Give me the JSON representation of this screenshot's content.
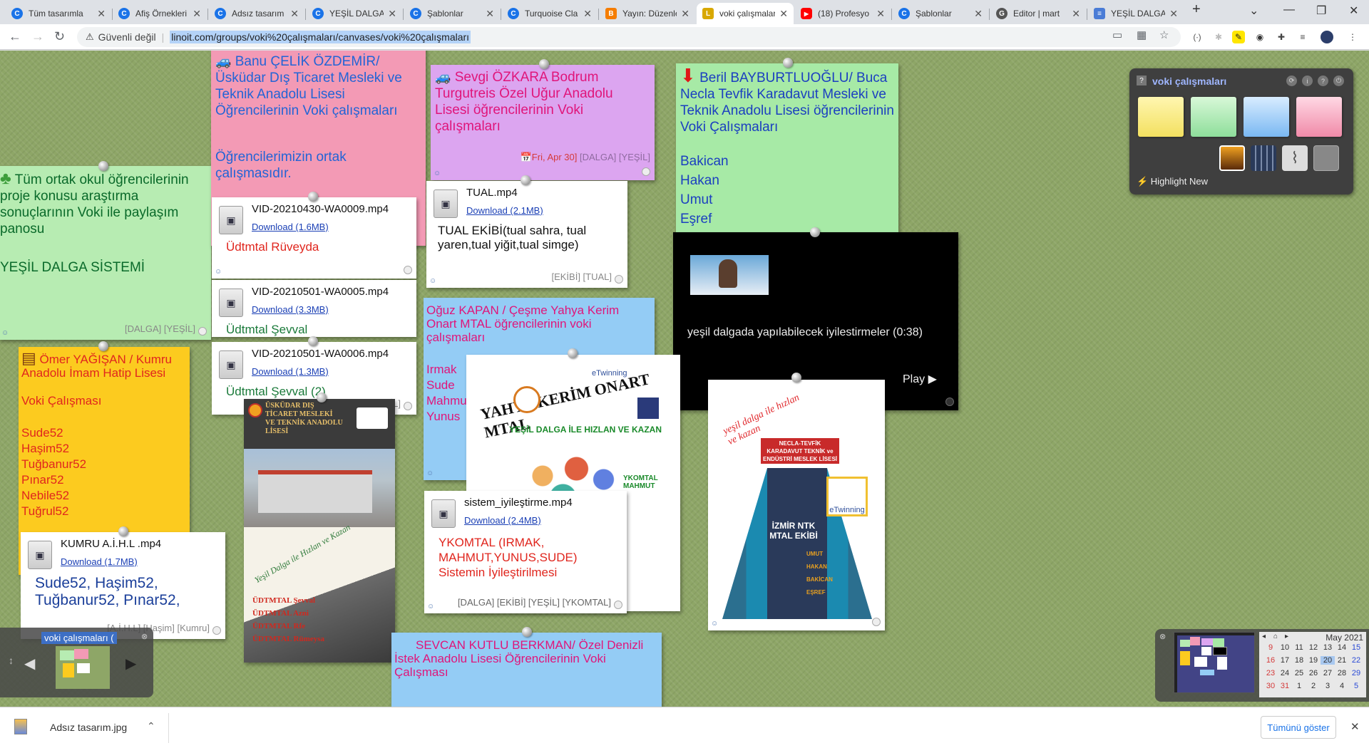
{
  "browser": {
    "tabs": [
      {
        "title": "Tüm tasarımla",
        "favicon": "C",
        "color": "#1a73e8"
      },
      {
        "title": "Afiş Örnekleri",
        "favicon": "C",
        "color": "#1a73e8"
      },
      {
        "title": "Adsız tasarım",
        "favicon": "C",
        "color": "#1a73e8"
      },
      {
        "title": "YEŞİL DALGA",
        "favicon": "C",
        "color": "#1a73e8"
      },
      {
        "title": "Şablonlar",
        "favicon": "C",
        "color": "#1a73e8"
      },
      {
        "title": "Turquoise Cla",
        "favicon": "C",
        "color": "#1a73e8"
      },
      {
        "title": "Yayın: Düzenle",
        "favicon": "B",
        "color": "#f57d00"
      },
      {
        "title": "voki çalışmaları",
        "favicon": "L",
        "color": "#d8a800"
      },
      {
        "title": "(18) Profesyo",
        "favicon": "▶",
        "color": "#ff0000"
      },
      {
        "title": "Şablonlar",
        "favicon": "C",
        "color": "#1a73e8"
      },
      {
        "title": "Editor | mart",
        "favicon": "G",
        "color": "#555"
      },
      {
        "title": "YEŞİL DALGA",
        "favicon": "≡",
        "color": "#4a7cd6"
      }
    ],
    "new_tab": "+",
    "address": {
      "warning": "⚠",
      "insecure_label": "Güvenli değil",
      "url": "linoit.com/groups/voki%20çalışmaları/canvases/voki%20çalışmaları"
    }
  },
  "notes": {
    "banu": {
      "title": "Banu ÇELİK ÖZDEMİR/ Üsküdar Dış Ticaret Mesleki ve Teknik Anadolu Lisesi Öğrencilerinin Voki çalışmaları",
      "body": "Öğrencilerimizin ortak çalışmasıdır."
    },
    "sevgi": {
      "title": "Sevgi ÖZKARA Bodrum Turgutreis Özel Uğur Anadolu Lisesi öğrencilerinin Voki çalışmaları",
      "date": "📅Fri, Apr 30]",
      "tags": "[DALGA] [YEŞİL]"
    },
    "beril": {
      "title": "Beril BAYBURTLUOĞLU/ Buca Necla Tevfik Karadavut Mesleki ve Teknik Anadolu Lisesi öğrencilerinin Voki Çalışmaları",
      "names": [
        "Bakican",
        "Hakan",
        "Umut",
        "Eşref"
      ]
    },
    "tum": {
      "title": "Tüm ortak okul öğrencilerinin proje konusu araştırma sonuçlarının Voki ile paylaşım panosu",
      "body": "YEŞİL DALGA SİSTEMİ",
      "tags": "[DALGA] [YEŞİL]"
    },
    "omer": {
      "title": "Ömer YAĞIŞAN / Kumru Anadolu İmam Hatip Lisesi",
      "subtitle": "Voki Çalışması",
      "names": [
        "Sude52",
        "Haşim52",
        "Tuğbanur52",
        "Pınar52",
        "Nebile52",
        "Tuğrul52"
      ]
    },
    "oguz": {
      "title": "Oğuz KAPAN / Çeşme Yahya Kerim Onart MTAL öğrencilerinin voki çalışmaları",
      "names": [
        "Irmak",
        "Sude",
        "Mahmut",
        "Yunus"
      ]
    },
    "sevcan": {
      "title": "SEVCAN KUTLU BERKMAN/ Özel Denizli İstek Anadolu Lisesi Öğrencilerinin Voki Çalışması"
    },
    "files": [
      {
        "name": "VID-20210430-WA0009.mp4",
        "download": "Download (1.6MB)",
        "caption": "Üdtmtal Rüveyda",
        "tags": ""
      },
      {
        "name": "VID-20210501-WA0005.mp4",
        "download": "Download (3.3MB)",
        "caption": "Üdtmtal Şevval",
        "tags": ""
      },
      {
        "name": "VID-20210501-WA0006.mp4",
        "download": "Download (1.3MB)",
        "caption": "Üdtmtal Şevval (2)",
        "tags": "[YEŞİL]"
      },
      {
        "name": "TUAL.mp4",
        "download": "Download (2.1MB)",
        "caption": "TUAL EKİBİ(tual sahra, tual yaren,tual yiğit,tual simge)",
        "tags": "[EKİBİ] [TUAL]"
      },
      {
        "name": "sistem_iyileştirme.mp4",
        "download": "Download (2.4MB)",
        "caption": "YKOMTAL (IRMAK, MAHMUT,YUNUS,SUDE) Sistemin İyileştirilmesi",
        "tags": "[DALGA] [EKİBİ] [YEŞİL] [YKOMTAL]"
      },
      {
        "name": "KUMRU A.İ.H.L .mp4",
        "download": "Download (1.7MB)",
        "caption": "Sude52, Haşim52, Tuğbanur52, Pınar52,",
        "tags": "[A.İ.H.L] [Haşim] [Kumru]"
      }
    ],
    "video": {
      "caption": "yeşil dalgada yapılabilecek iyilestirmeler (0:38)",
      "play": "Play"
    },
    "poster_yahya": {
      "heading": "YAHYA KERİM ONART MTAL",
      "slogan": "YEŞİL DALGA İLE HIZLAN VE KAZAN",
      "badge": "eTwinning",
      "side": "YKOMTAL MAHMUT"
    },
    "poster_uskudar": {
      "heading": "ÜSKÜDAR DIŞ TİCARET MESLEKİ VE TEKNİK ANADOLU LİSESİ",
      "slogan": "Yeşil Dalga ile Hızlan ve Kazan",
      "names": [
        "ÜDTMTAL Şevval",
        "ÜDTMTAL Azni",
        "ÜDTMTAL Rfe",
        "ÜDTMTAL Rümeysa"
      ]
    },
    "poster_izmir": {
      "slogan": "yeşil dalga ile hızlan ve kazan",
      "banner": "NECLA-TEVFİK KARADAVUT TEKNİK ve ENDÜSTRİ MESLEK LİSESİ",
      "road_text": "İZMİR NTK MTAL EKİBİ",
      "names": [
        "UMUT",
        "HAKAN",
        "BAKİCAN",
        "EŞREF"
      ],
      "badge": "eTwinning"
    }
  },
  "widget": {
    "title": "voki çalışmaları",
    "highlight": "⚡ Highlight New",
    "swatch_colors": [
      "#f3e77a",
      "#9fe6a8",
      "#8fc8f7",
      "#f4a2b8"
    ]
  },
  "thumbnail": {
    "label": "voki çalışmaları ("
  },
  "calendar": {
    "month": "May 2021",
    "rows": [
      [
        "9",
        "10",
        "11",
        "12",
        "13",
        "14",
        "15"
      ],
      [
        "16",
        "17",
        "18",
        "19",
        "20",
        "21",
        "22"
      ],
      [
        "23",
        "24",
        "25",
        "26",
        "27",
        "28",
        "29"
      ],
      [
        "30",
        "31",
        "1",
        "2",
        "3",
        "4",
        "5"
      ]
    ]
  },
  "downloads": {
    "file": "Adsız tasarım.jpg",
    "show_all": "Tümünü göster",
    "close": "✕"
  },
  "icons": {
    "note_smile": "☺",
    "play_arrow": "▶"
  }
}
